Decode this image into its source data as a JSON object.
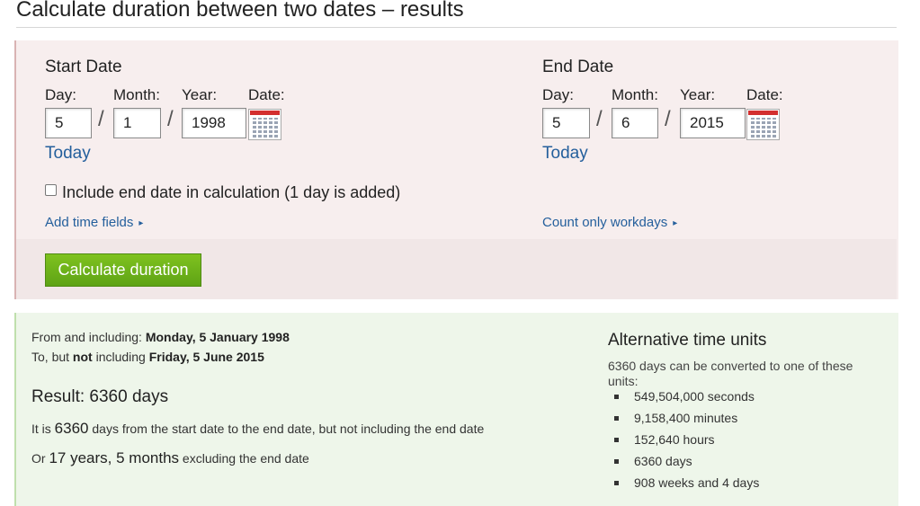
{
  "page_title": "Calculate duration between two dates – results",
  "labels": {
    "day": "Day:",
    "month": "Month:",
    "year": "Year:",
    "date": "Date:",
    "slash": "/"
  },
  "start": {
    "heading": "Start Date",
    "day": "5",
    "month": "1",
    "year": "1998",
    "today_link": "Today"
  },
  "end": {
    "heading": "End Date",
    "day": "5",
    "month": "6",
    "year": "2015",
    "today_link": "Today"
  },
  "include_end_date": {
    "label": "Include end date in calculation (1 day is added)",
    "checked": false
  },
  "add_time_fields_link": "Add time fields",
  "count_workdays_link": "Count only workdays",
  "link_arrow": "▸",
  "calculate_button": "Calculate duration",
  "result": {
    "from_prefix": "From and including: ",
    "from_date": "Monday, 5 January 1998",
    "to_prefix": "To, but ",
    "to_not": "not",
    "to_middle": " including ",
    "to_date": "Friday, 5 June 2015",
    "heading": "Result: 6360 days",
    "sentence_prefix": "It is ",
    "sentence_days": "6360",
    "sentence_suffix": " days from the start date to the end date, but not including the end date",
    "or_prefix": "Or ",
    "or_duration": "17 years, 5 months",
    "or_suffix": " excluding the end date"
  },
  "alternative": {
    "heading": "Alternative time units",
    "description": "6360 days can be converted to one of these units:",
    "units": [
      "549,504,000 seconds",
      "9,158,400 minutes",
      "152,640 hours",
      "6360 days",
      "908 weeks and 4 days"
    ]
  },
  "colors": {
    "link": "#245f9c",
    "button_green": "#6cb31a",
    "form_bg": "#f7eeee",
    "result_bg": "#eef6ea"
  }
}
